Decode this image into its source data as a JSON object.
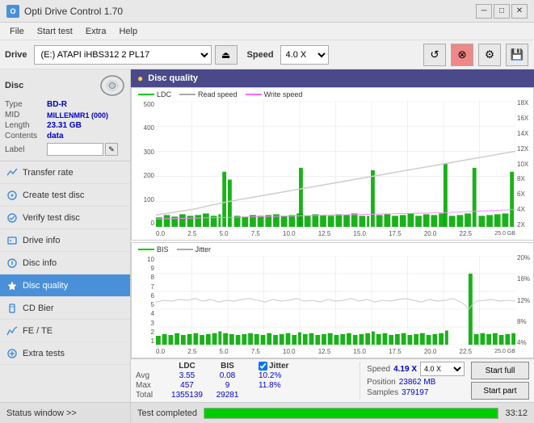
{
  "app": {
    "title": "Opti Drive Control 1.70",
    "icon": "O"
  },
  "titlebar": {
    "minimize_label": "─",
    "maximize_label": "□",
    "close_label": "✕"
  },
  "menu": {
    "items": [
      "File",
      "Start test",
      "Extra",
      "Help"
    ]
  },
  "toolbar": {
    "drive_label": "Drive",
    "drive_value": "(E:) ATAPI iHBS312  2 PL17",
    "speed_label": "Speed",
    "speed_value": "4.0 X",
    "eject_icon": "⏏"
  },
  "disc": {
    "title": "Disc",
    "type_label": "Type",
    "type_value": "BD-R",
    "mid_label": "MID",
    "mid_value": "MILLENMR1 (000)",
    "length_label": "Length",
    "length_value": "23.31 GB",
    "contents_label": "Contents",
    "contents_value": "data",
    "label_label": "Label"
  },
  "nav": {
    "items": [
      {
        "id": "transfer-rate",
        "label": "Transfer rate",
        "icon": "📊"
      },
      {
        "id": "create-test-disc",
        "label": "Create test disc",
        "icon": "💿"
      },
      {
        "id": "verify-test-disc",
        "label": "Verify test disc",
        "icon": "✅"
      },
      {
        "id": "drive-info",
        "label": "Drive info",
        "icon": "ℹ"
      },
      {
        "id": "disc-info",
        "label": "Disc info",
        "icon": "📋"
      },
      {
        "id": "disc-quality",
        "label": "Disc quality",
        "icon": "⭐",
        "active": true
      },
      {
        "id": "cd-bier",
        "label": "CD Bier",
        "icon": "🍺"
      },
      {
        "id": "fe-te",
        "label": "FE / TE",
        "icon": "📈"
      },
      {
        "id": "extra-tests",
        "label": "Extra tests",
        "icon": "🔧"
      }
    ]
  },
  "status_window": {
    "label": "Status window >>",
    "chevron": ">>"
  },
  "content": {
    "header": "Disc quality",
    "header_icon": "●",
    "upper_chart": {
      "legend": [
        {
          "label": "LDC",
          "color": "#00aa00"
        },
        {
          "label": "Read speed",
          "color": "#ffffff"
        },
        {
          "label": "Write speed",
          "color": "#ff00ff"
        }
      ],
      "y_axis_left": [
        "500",
        "400",
        "300",
        "200",
        "100",
        "0"
      ],
      "y_axis_right": [
        "18X",
        "16X",
        "14X",
        "12X",
        "10X",
        "8X",
        "6X",
        "4X",
        "2X"
      ],
      "x_axis": [
        "0.0",
        "2.5",
        "5.0",
        "7.5",
        "10.0",
        "12.5",
        "15.0",
        "17.5",
        "20.0",
        "22.5",
        "25.0"
      ],
      "x_unit": "GB"
    },
    "lower_chart": {
      "legend": [
        {
          "label": "BIS",
          "color": "#00aa00"
        },
        {
          "label": "Jitter",
          "color": "#ffffff"
        }
      ],
      "y_axis_left": [
        "10",
        "9",
        "8",
        "7",
        "6",
        "5",
        "4",
        "3",
        "2",
        "1"
      ],
      "y_axis_right": [
        "20%",
        "16%",
        "12%",
        "8%",
        "4%"
      ],
      "x_axis": [
        "0.0",
        "2.5",
        "5.0",
        "7.5",
        "10.0",
        "12.5",
        "15.0",
        "17.5",
        "20.0",
        "22.5",
        "25.0"
      ],
      "x_unit": "GB"
    }
  },
  "stats": {
    "col_headers": [
      "LDC",
      "BIS",
      "",
      "Jitter",
      "Speed"
    ],
    "jitter_checked": true,
    "jitter_label": "Jitter",
    "speed_val": "4.19 X",
    "speed_select": "4.0 X",
    "rows": [
      {
        "label": "Avg",
        "ldc": "3.55",
        "bis": "0.08",
        "jitter": "10.2%"
      },
      {
        "label": "Max",
        "ldc": "457",
        "bis": "9",
        "jitter": "11.8%",
        "position_label": "Position",
        "position_val": "23862 MB"
      },
      {
        "label": "Total",
        "ldc": "1355139",
        "bis": "29281",
        "samples_label": "Samples",
        "samples_val": "379197"
      }
    ],
    "start_full_label": "Start full",
    "start_part_label": "Start part"
  },
  "bottom": {
    "status_text": "Test completed",
    "progress": 100,
    "time": "33:12"
  },
  "colors": {
    "active_nav": "#4a90d9",
    "ldc_bar": "#00cc00",
    "bis_bar": "#00cc00",
    "read_speed_line": "#ffffff",
    "jitter_line": "#cccccc",
    "progress_fill": "#00cc00",
    "content_header_bg": "#4a4a8a",
    "accent_blue": "#0000cc"
  }
}
